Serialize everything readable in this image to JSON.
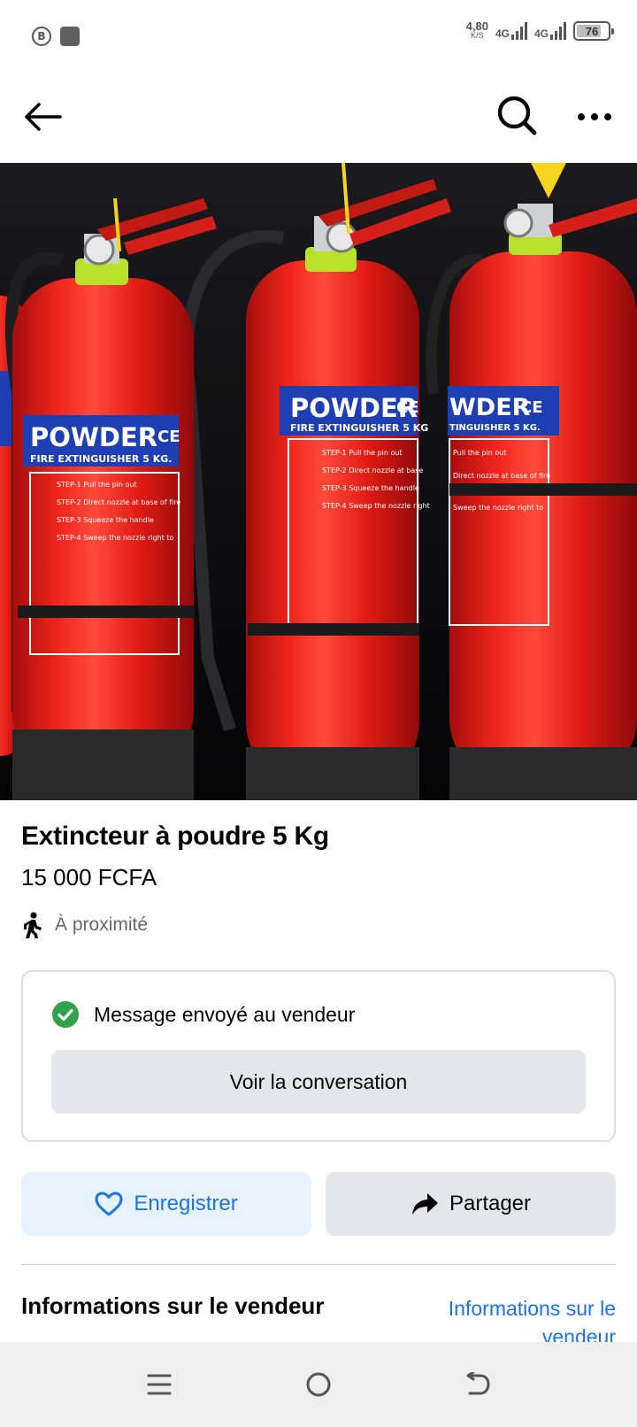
{
  "status_bar": {
    "speed_value": "4,80",
    "speed_unit": "K/S",
    "network_1": "4G",
    "network_2": "4G",
    "battery_level": "76",
    "left_icon_letter": "B"
  },
  "nav": {
    "back_icon": "arrow-left-icon",
    "search_icon": "search-icon",
    "more_icon": "more-horizontal-icon"
  },
  "product": {
    "image": {
      "description_labels": {
        "brand_text": "POWDER",
        "ce": "CE",
        "subtitle": "FIRE EXTINGUISHER 5 KG."
      }
    },
    "title": "Extincteur à poudre 5 Kg",
    "price": "15 000 FCFA",
    "location_label": "À proximité"
  },
  "message_card": {
    "status_text": "Message envoyé au vendeur",
    "button_label": "Voir la conversation"
  },
  "actions": {
    "save_label": "Enregistrer",
    "share_label": "Partager"
  },
  "seller": {
    "heading": "Informations sur le vendeur",
    "link": "Informations sur le vendeur"
  },
  "colors": {
    "accent": "#1b74e4",
    "success": "#31a24c",
    "button_gray": "#e4e6eb",
    "save_bg": "#e7f3ff"
  }
}
